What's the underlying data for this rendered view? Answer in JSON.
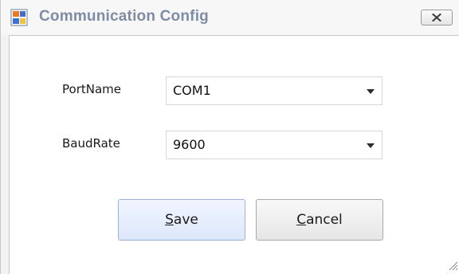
{
  "window": {
    "title": "Communication Config",
    "icons": {
      "app": "app-window-icon",
      "close": "close-x-icon",
      "grip": "resize-grip-icon",
      "dropdown": "chevron-down-icon"
    }
  },
  "form": {
    "port": {
      "label": "PortName",
      "value": "COM1"
    },
    "baud": {
      "label": "BaudRate",
      "value": "9600"
    }
  },
  "buttons": {
    "save": {
      "mnemonic": "S",
      "rest": "ave"
    },
    "cancel": {
      "mnemonic": "C",
      "rest": "ancel"
    }
  },
  "colors": {
    "title_text": "#7f8ca3",
    "primary_button_top": "#f0f5ff",
    "primary_button_bottom": "#dde8fb",
    "primary_button_border": "#9db1d6"
  }
}
